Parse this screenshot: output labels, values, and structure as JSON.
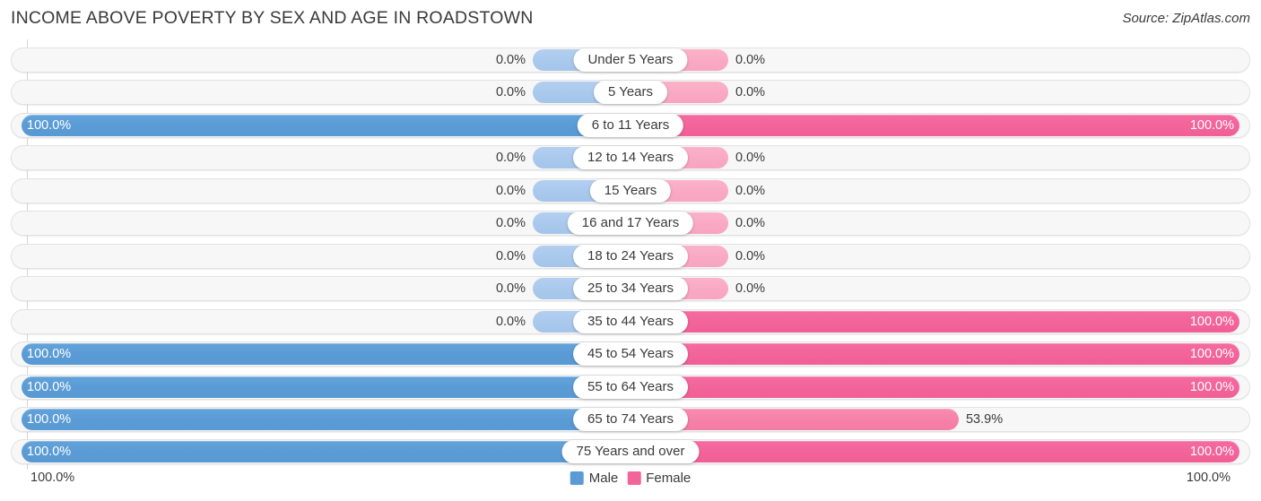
{
  "header": {
    "title": "INCOME ABOVE POVERTY BY SEX AND AGE IN ROADSTOWN",
    "source": "Source: ZipAtlas.com"
  },
  "footer": {
    "axis_left": "100.0%",
    "axis_right": "100.0%",
    "legend": [
      {
        "label": "Male",
        "color": "#5b9bd5"
      },
      {
        "label": "Female",
        "color": "#f2649a"
      }
    ]
  },
  "colors": {
    "male_full": "#5b9bd5",
    "male_zero": "#a8c8ec",
    "female_full": "#f2649a",
    "female_mid": "#f581a8",
    "female_zero": "#f9a8c4",
    "track": "#f7f7f7",
    "gridline": "#d4d4d4"
  },
  "chart_data": {
    "type": "bar",
    "subtype": "diverging-bidirectional",
    "title": "INCOME ABOVE POVERTY BY SEX AND AGE IN ROADSTOWN",
    "xlabel": "",
    "ylabel": "",
    "xlim": [
      0,
      100
    ],
    "grid": true,
    "legend_position": "bottom-center",
    "axis_tick_labels": [
      "100.0%",
      "100.0%"
    ],
    "categories": [
      "Under 5 Years",
      "5 Years",
      "6 to 11 Years",
      "12 to 14 Years",
      "15 Years",
      "16 and 17 Years",
      "18 to 24 Years",
      "25 to 34 Years",
      "35 to 44 Years",
      "45 to 54 Years",
      "55 to 64 Years",
      "65 to 74 Years",
      "75 Years and over"
    ],
    "series": [
      {
        "name": "Male",
        "direction": "left",
        "color": "#5b9bd5",
        "values": [
          0.0,
          0.0,
          100.0,
          0.0,
          0.0,
          0.0,
          0.0,
          0.0,
          0.0,
          100.0,
          100.0,
          100.0,
          100.0
        ],
        "labels": [
          "0.0%",
          "0.0%",
          "100.0%",
          "0.0%",
          "0.0%",
          "0.0%",
          "0.0%",
          "0.0%",
          "0.0%",
          "100.0%",
          "100.0%",
          "100.0%",
          "100.0%"
        ]
      },
      {
        "name": "Female",
        "direction": "right",
        "color": "#f2649a",
        "values": [
          0.0,
          0.0,
          100.0,
          0.0,
          0.0,
          0.0,
          0.0,
          0.0,
          100.0,
          100.0,
          100.0,
          53.9,
          100.0
        ],
        "labels": [
          "0.0%",
          "0.0%",
          "100.0%",
          "0.0%",
          "0.0%",
          "0.0%",
          "0.0%",
          "0.0%",
          "100.0%",
          "100.0%",
          "100.0%",
          "53.9%",
          "100.0%"
        ]
      }
    ]
  }
}
